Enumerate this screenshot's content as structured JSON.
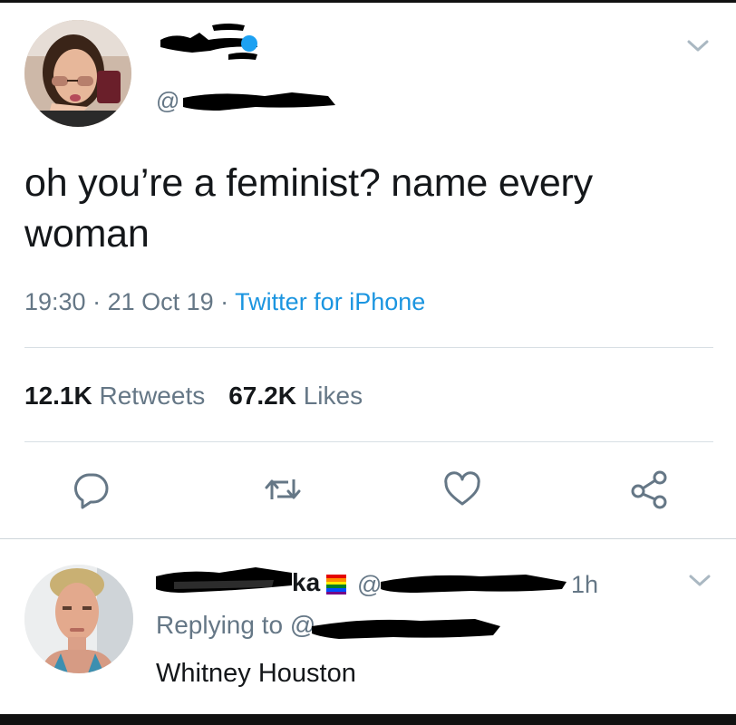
{
  "tweet": {
    "handle_prefix": "@",
    "text": "oh you’re a feminist? name every woman",
    "time": "19:30",
    "date": "21 Oct 19",
    "client": "Twitter for iPhone",
    "retweets_count": "12.1K",
    "retweets_label": "Retweets",
    "likes_count": "67.2K",
    "likes_label": "Likes"
  },
  "reply": {
    "name_suffix": "ka",
    "handle_prefix": "@",
    "time": "1h",
    "replying_label": "Replying to @",
    "text": "Whitney Houston"
  },
  "actions": {
    "icons": [
      "reply-icon",
      "retweet-icon",
      "like-icon",
      "share-icon"
    ]
  },
  "colors": {
    "text": "#14171a",
    "secondary": "#657786",
    "link": "#1b95e0",
    "redaction": "#000000"
  }
}
